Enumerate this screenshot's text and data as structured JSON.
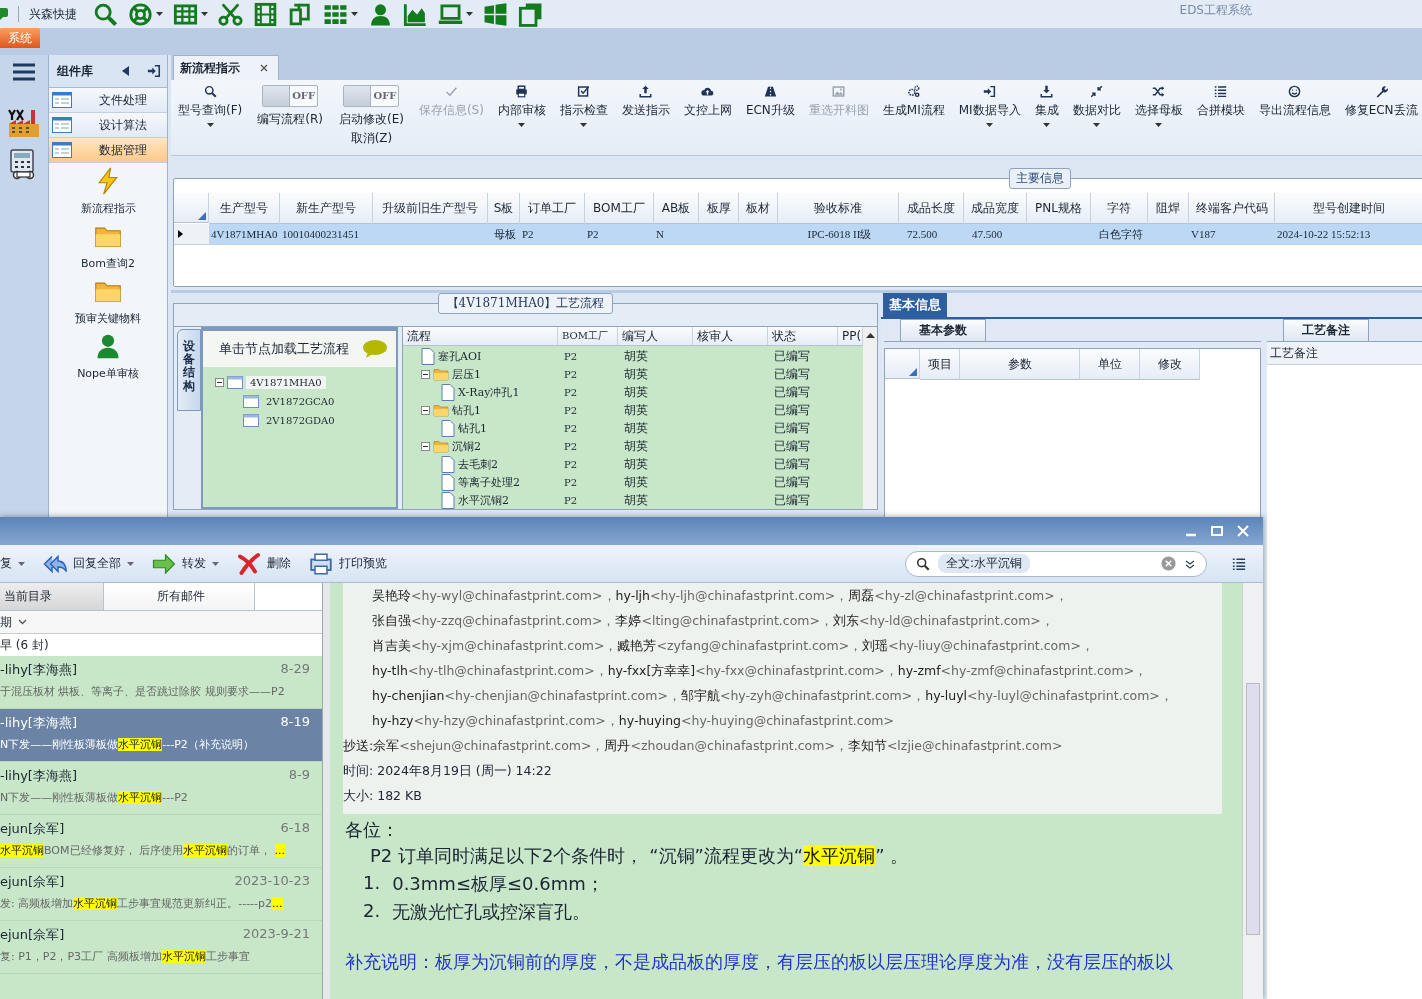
{
  "quick_bar": {
    "title": "兴森快捷",
    "tools": [
      {
        "kind": "search",
        "dropdown": false
      },
      {
        "kind": "lifebuoy",
        "dropdown": true
      },
      {
        "kind": "table",
        "dropdown": true
      },
      {
        "kind": "scissors",
        "dropdown": false
      },
      {
        "kind": "film",
        "dropdown": false
      },
      {
        "kind": "copy",
        "dropdown": false
      },
      {
        "kind": "grid",
        "dropdown": true
      },
      {
        "kind": "person",
        "dropdown": false
      },
      {
        "kind": "chart",
        "dropdown": false
      },
      {
        "kind": "laptop",
        "dropdown": true
      },
      {
        "kind": "tiles",
        "dropdown": false
      },
      {
        "kind": "pages",
        "dropdown": false
      }
    ]
  },
  "app_title": "EDS工程系统",
  "menu_tabs": [
    {
      "label": "系统",
      "selected": true
    }
  ],
  "sidebar": {
    "title": "组件库",
    "items": [
      {
        "label": "文件处理",
        "selected": false
      },
      {
        "label": "设计算法",
        "selected": false
      },
      {
        "label": "数据管理",
        "selected": true
      }
    ],
    "tools": [
      {
        "label": "新流程指示",
        "kind": "lightning"
      },
      {
        "label": "Bom查询2",
        "kind": "folder"
      },
      {
        "label": "预审关键物料",
        "kind": "folder"
      },
      {
        "label": "Nope单审核",
        "kind": "person"
      }
    ]
  },
  "doc_tabs": [
    {
      "label": "新流程指示",
      "selected": true
    }
  ],
  "toolbar": [
    {
      "kind": "search",
      "label": "型号查询(F)",
      "disabled": false,
      "dropdown": true
    },
    {
      "kind": "toggle",
      "labels": [
        "编写流程(R)"
      ],
      "switch_text": "OFF",
      "on": false
    },
    {
      "kind": "toggle",
      "labels": [
        "启动修改(E)",
        "取消(Z)"
      ],
      "switch_text": "OFF",
      "on": false
    },
    {
      "kind": "check",
      "label": "保存信息(S)",
      "disabled": true,
      "dropdown": false
    },
    {
      "kind": "printer",
      "label": "内部审核",
      "disabled": false,
      "dropdown": true
    },
    {
      "kind": "checkbox",
      "label": "指示检查",
      "disabled": false,
      "dropdown": true
    },
    {
      "kind": "upload",
      "label": "发送指示",
      "disabled": false,
      "dropdown": false
    },
    {
      "kind": "cloud",
      "label": "文控上网",
      "disabled": false,
      "dropdown": false
    },
    {
      "kind": "road",
      "label": "ECN升级",
      "disabled": false,
      "dropdown": false
    },
    {
      "kind": "image",
      "label": "重选开料图",
      "disabled": true,
      "dropdown": false
    },
    {
      "kind": "gears",
      "label": "生成MI流程",
      "disabled": false,
      "dropdown": false
    },
    {
      "kind": "signin",
      "label": "MI数据导入",
      "disabled": false,
      "dropdown": true
    },
    {
      "kind": "download",
      "label": "集成",
      "disabled": false,
      "dropdown": true
    },
    {
      "kind": "compress",
      "label": "数据对比",
      "disabled": false,
      "dropdown": true
    },
    {
      "kind": "shuffle",
      "label": "选择母板",
      "disabled": false,
      "dropdown": true
    },
    {
      "kind": "list",
      "label": "合拼模块",
      "disabled": false,
      "dropdown": false
    },
    {
      "kind": "smiley",
      "label": "导出流程信息",
      "disabled": false,
      "dropdown": false
    },
    {
      "kind": "wrench",
      "label": "修复ECN丢流",
      "disabled": false,
      "dropdown": false
    }
  ],
  "main_info": {
    "title": "主要信息",
    "columns": [
      "生产型号",
      "新生产型号",
      "升级前旧生产型号",
      "S板",
      "订单工厂",
      "BOM工厂",
      "AB板",
      "板厚",
      "板材",
      "验收标准",
      "成品长度",
      "成品宽度",
      "PNL规格",
      "字符",
      "阻焊",
      "终端客户代码",
      "型号创建时间"
    ],
    "rows": [
      {
        "selected": true,
        "cells": [
          "4V1871MHA0",
          "10010400231451",
          null,
          "母板",
          "P2",
          "P2",
          "N",
          null,
          null,
          "IPC-6018 II级",
          "72.500",
          "47.500",
          null,
          "白色字符",
          null,
          "V187",
          "2024-10-22 15:52:13"
        ]
      }
    ]
  },
  "process": {
    "title": "【4V1871MHA0】工艺流程",
    "side_tab": "设备结构",
    "tree_header": "单击节点加载工艺流程",
    "tree": [
      {
        "label": "4V1871MHA0",
        "expanded": true,
        "selected": true,
        "children": [
          {
            "label": "2V1872GCA0",
            "selected": false
          },
          {
            "label": "2V1872GDA0",
            "selected": false
          }
        ]
      }
    ],
    "columns": [
      "流程",
      "BOM工厂",
      "编写人",
      "核审人",
      "状态",
      "PP("
    ],
    "steps": [
      {
        "name": "塞孔AOI",
        "factory": "P2",
        "author": "胡英",
        "status": "已编写"
      },
      {
        "name": "层压1",
        "factory": "P2",
        "author": "胡英",
        "status": "已编写",
        "expanded": true,
        "children": [
          {
            "name": "X-Ray冲孔1",
            "factory": "P2",
            "author": "胡英",
            "status": "已编写"
          }
        ]
      },
      {
        "name": "钻孔1",
        "factory": "P2",
        "author": "胡英",
        "status": "已编写",
        "expanded": true,
        "children": [
          {
            "name": "钻孔1",
            "factory": "P2",
            "author": "胡英",
            "status": "已编写"
          }
        ]
      },
      {
        "name": "沉铜2",
        "factory": "P2",
        "author": "胡英",
        "status": "已编写",
        "expanded": true,
        "children": [
          {
            "name": "去毛刺2",
            "factory": "P2",
            "author": "胡英",
            "status": "已编写"
          },
          {
            "name": "等离子处理2",
            "factory": "P2",
            "author": "胡英",
            "status": "已编写"
          },
          {
            "name": "水平沉铜2",
            "factory": "P2",
            "author": "胡英",
            "status": "已编写"
          }
        ]
      }
    ]
  },
  "basic_info": {
    "tab": "基本信息",
    "params_tab": "基本参数",
    "columns": [
      "项目",
      "参数",
      "单位",
      "修改"
    ],
    "notes_tab": "工艺备注",
    "notes_header": "工艺备注"
  },
  "mail": {
    "toolbar": [
      {
        "label": "复",
        "kind": "plain",
        "dropdown": true
      },
      {
        "label": "回复全部",
        "kind": "replyall",
        "dropdown": true
      },
      {
        "label": "转发",
        "kind": "forward",
        "dropdown": true
      },
      {
        "label": "删除",
        "kind": "delete",
        "dropdown": false
      },
      {
        "label": "打印预览",
        "kind": "print",
        "dropdown": false
      }
    ],
    "search": {
      "token": "全文:水平沉铜"
    },
    "tabs": [
      {
        "label": "当前目录",
        "selected": true
      },
      {
        "label": "所有邮件",
        "selected": false
      }
    ],
    "sort": "期",
    "group": "早 (6 封)",
    "items": [
      {
        "sender": "-lihy[李海燕]",
        "date": "8-29",
        "selected": false,
        "subject": [
          {
            "text": "于混压板材 烘板、等离子、是否跳过除胶 规则要求——P2",
            "highlight": false
          }
        ]
      },
      {
        "sender": "-lihy[李海燕]",
        "date": "8-19",
        "selected": true,
        "subject": [
          {
            "text": "N下发——刚性板薄板做",
            "highlight": false
          },
          {
            "text": "水平沉铜",
            "highlight": true
          },
          {
            "text": "---P2（补充说明）",
            "highlight": false
          }
        ]
      },
      {
        "sender": "-lihy[李海燕]",
        "date": "8-9",
        "selected": false,
        "subject": [
          {
            "text": "N下发——刚性板薄板做",
            "highlight": false
          },
          {
            "text": "水平沉铜",
            "highlight": true
          },
          {
            "text": "---P2",
            "highlight": false
          }
        ]
      },
      {
        "sender": "ejun[佘军]",
        "date": "6-18",
        "selected": false,
        "subject": [
          {
            "text": "水平沉铜",
            "highlight": true
          },
          {
            "text": "BOM已经修复好， 后序使用",
            "highlight": false
          },
          {
            "text": "水平沉铜",
            "highlight": true
          },
          {
            "text": "的订单， ",
            "highlight": false
          },
          {
            "text": "...",
            "highlight": true
          }
        ]
      },
      {
        "sender": "ejun[佘军]",
        "date": "2023-10-23",
        "selected": false,
        "subject": [
          {
            "text": "发: 高频板增加",
            "highlight": false
          },
          {
            "text": "水平沉铜",
            "highlight": true
          },
          {
            "text": "工步事宜规范更新纠正。-----p2",
            "highlight": false
          },
          {
            "text": "...",
            "highlight": true
          }
        ]
      },
      {
        "sender": "ejun[佘军]",
        "date": "2023-9-21",
        "selected": false,
        "subject": [
          {
            "text": "复: P1，P2，P3工厂 高频板增加",
            "highlight": false
          },
          {
            "text": "水平沉铜",
            "highlight": true
          },
          {
            "text": "工步事宜",
            "highlight": false
          }
        ]
      }
    ],
    "recipients": [
      [
        {
          "name": "吴艳玲",
          "address": "<hy-wyl@chinafastprint.com>，"
        },
        {
          "name": "hy-ljh",
          "address": "<hy-ljh@chinafastprint.com>，"
        },
        {
          "name": "周磊",
          "address": "<hy-zl@chinafastprint.com>，"
        }
      ],
      [
        {
          "name": "张自强",
          "address": "<hy-zzq@chinafastprint.com>，"
        },
        {
          "name": "李婷",
          "address": "<lting@chinafastprint.com>，"
        },
        {
          "name": "刘东",
          "address": "<hy-ld@chinafastprint.com>，"
        }
      ],
      [
        {
          "name": "肖吉美",
          "address": "<hy-xjm@chinafastprint.com>，"
        },
        {
          "name": "臧艳芳",
          "address": "<zyfang@chinafastprint.com>，"
        },
        {
          "name": "刘瑶",
          "address": "<hy-liuy@chinafastprint.com>，"
        }
      ],
      [
        {
          "name": "hy-tlh",
          "address": "<hy-tlh@chinafastprint.com>，"
        },
        {
          "name": "hy-fxx[方幸幸]",
          "address": "<hy-fxx@chinafastprint.com>，"
        },
        {
          "name": "hy-zmf",
          "address": "<hy-zmf@chinafastprint.com>，"
        }
      ],
      [
        {
          "name": "hy-chenjian",
          "address": "<hy-chenjian@chinafastprint.com>，"
        },
        {
          "name": "邹宇航",
          "address": "<hy-zyh@chinafastprint.com>，"
        },
        {
          "name": "hy-luyl",
          "address": "<hy-luyl@chinafastprint.com>，"
        }
      ],
      [
        {
          "name": "hy-hzy",
          "address": "<hy-hzy@chinafastprint.com>，"
        },
        {
          "name": "hy-huying",
          "address": "<hy-huying@chinafastprint.com>"
        }
      ]
    ],
    "cc": {
      "label": "抄送:",
      "people": [
        {
          "name": "佘军",
          "address": "<shejun@chinafastprint.com>，"
        },
        {
          "name": "周丹",
          "address": "<zhoudan@chinafastprint.com>，"
        },
        {
          "name": "李知节",
          "address": "<lzjie@chinafastprint.com>"
        }
      ]
    },
    "time": {
      "label": "时间:",
      "value": "2024年8月19日 (周一) 14:22"
    },
    "size": {
      "label": "大小:",
      "value": "182 KB"
    },
    "body": {
      "greeting": "各位：",
      "paragraph": [
        {
          "text": "P2 订单同时满足以下2个条件时，  “沉铜”流程更改为“",
          "highlight": false
        },
        {
          "text": "水平沉铜",
          "highlight": true
        },
        {
          "text": "” 。",
          "highlight": false
        }
      ],
      "list": [
        {
          "number": "1.",
          "text": "0.3mm≤板厚≤0.6mm；"
        },
        {
          "number": "2.",
          "text": "无激光忙孔或控深盲孔。"
        }
      ],
      "note": "补充说明：板厚为沉铜前的厚度，不是成品板的厚度，有层压的板以层压理论厚度为准，没有层压的板以"
    }
  }
}
